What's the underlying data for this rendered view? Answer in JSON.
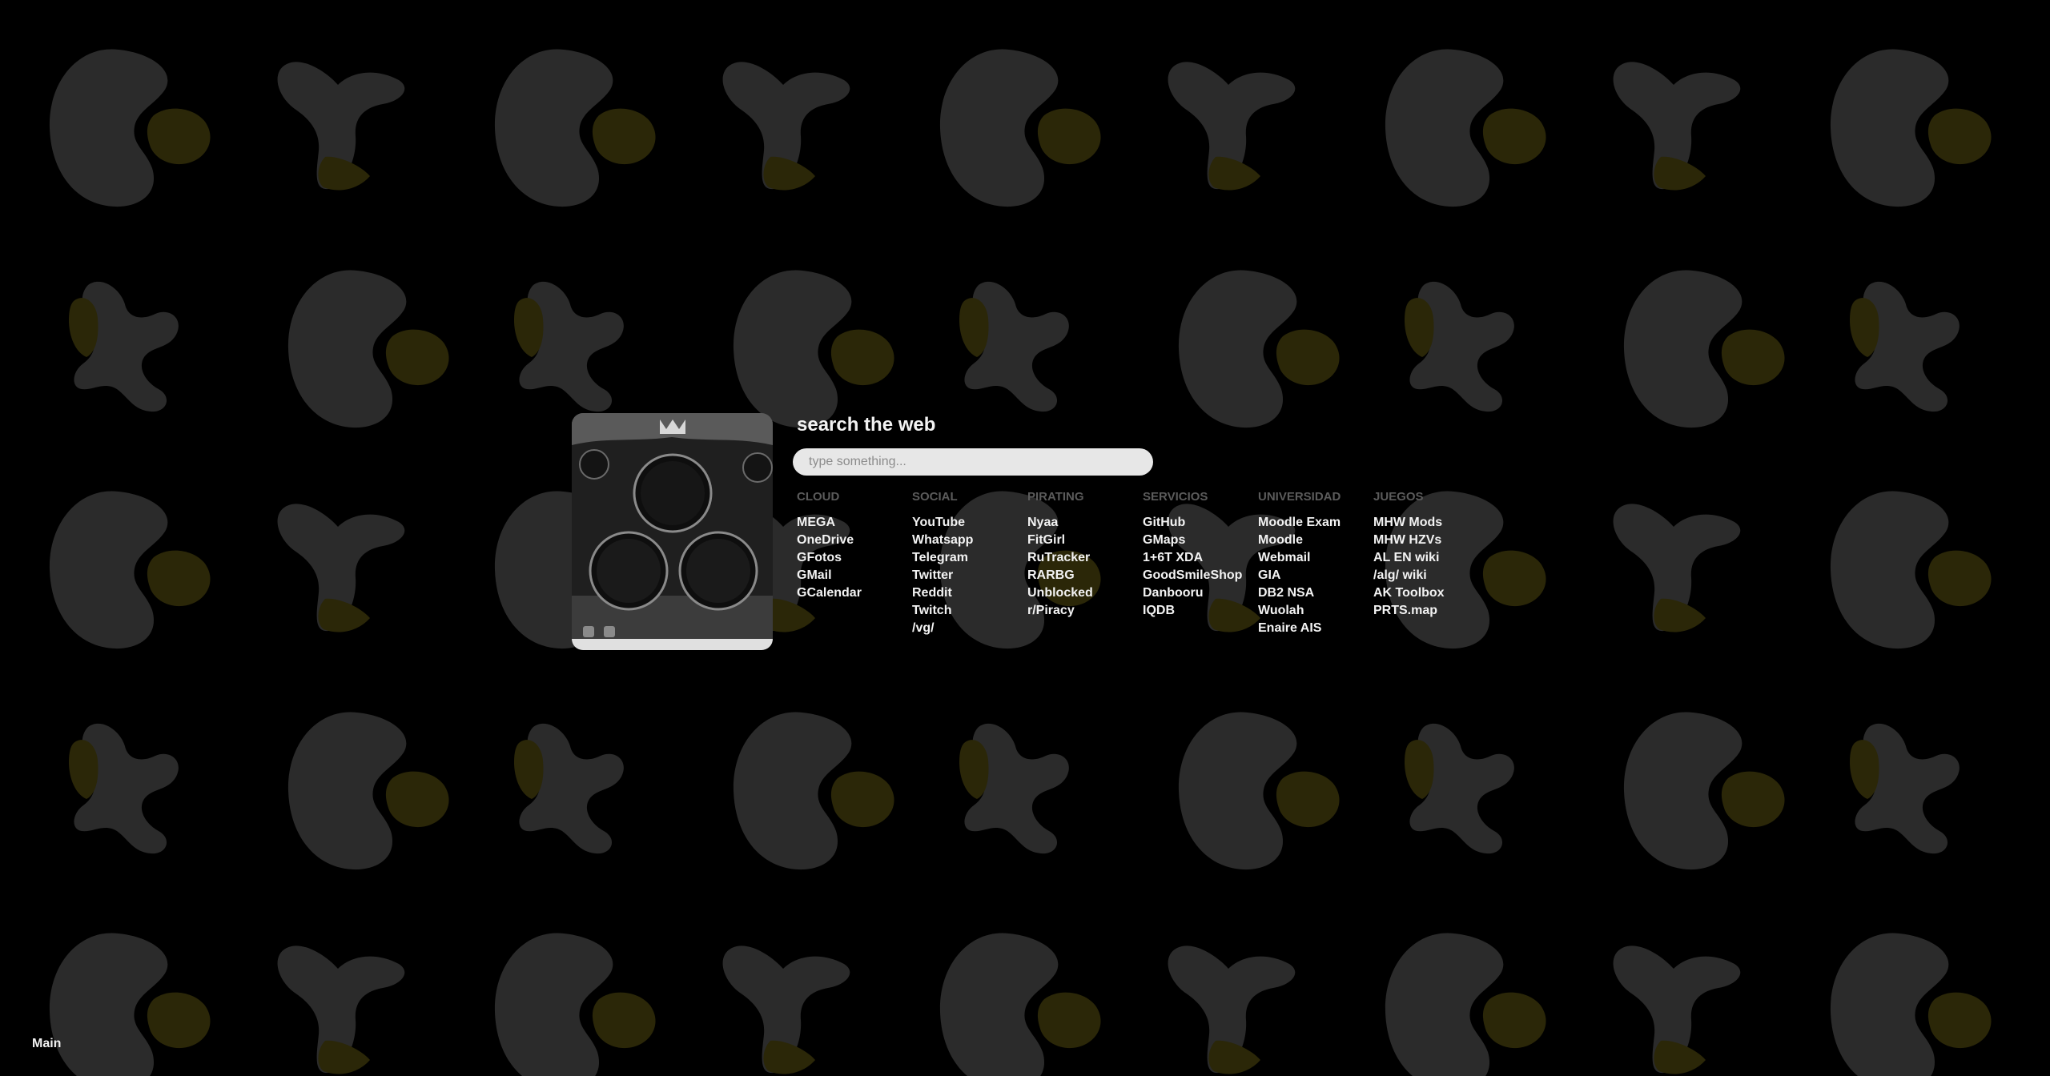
{
  "background": {
    "pattern": "bean-and-leaf",
    "base_color": "#000000",
    "shape_color": "#2b2b2b",
    "accent_color": "#2b2708"
  },
  "thumbnail": {
    "icon": "launcher-image"
  },
  "search": {
    "title": "search the web",
    "placeholder": "type something...",
    "value": ""
  },
  "categories": [
    {
      "name": "CLOUD",
      "links": [
        "MEGA",
        "OneDrive",
        "GFotos",
        "GMail",
        "GCalendar"
      ]
    },
    {
      "name": "SOCIAL",
      "links": [
        "YouTube",
        "Whatsapp",
        "Telegram",
        "Twitter",
        "Reddit",
        "Twitch",
        "/vg/"
      ]
    },
    {
      "name": "PIRATING",
      "links": [
        "Nyaa",
        "FitGirl",
        "RuTracker",
        "RARBG",
        "Unblocked",
        "r/Piracy"
      ]
    },
    {
      "name": "SERVICIOS",
      "links": [
        "GitHub",
        "GMaps",
        "1+6T XDA",
        "GoodSmileShop",
        "Danbooru",
        "IQDB"
      ]
    },
    {
      "name": "UNIVERSIDAD",
      "links": [
        "Moodle Exam",
        "Moodle",
        "Webmail",
        "GIA",
        "DB2 NSA",
        "Wuolah",
        "Enaire AIS"
      ]
    },
    {
      "name": "JUEGOS",
      "links": [
        "MHW Mods",
        "MHW HZVs",
        "AL EN wiki",
        "/alg/ wiki",
        "AK Toolbox",
        "PRTS.map"
      ]
    }
  ],
  "footer": {
    "label": "Main"
  }
}
